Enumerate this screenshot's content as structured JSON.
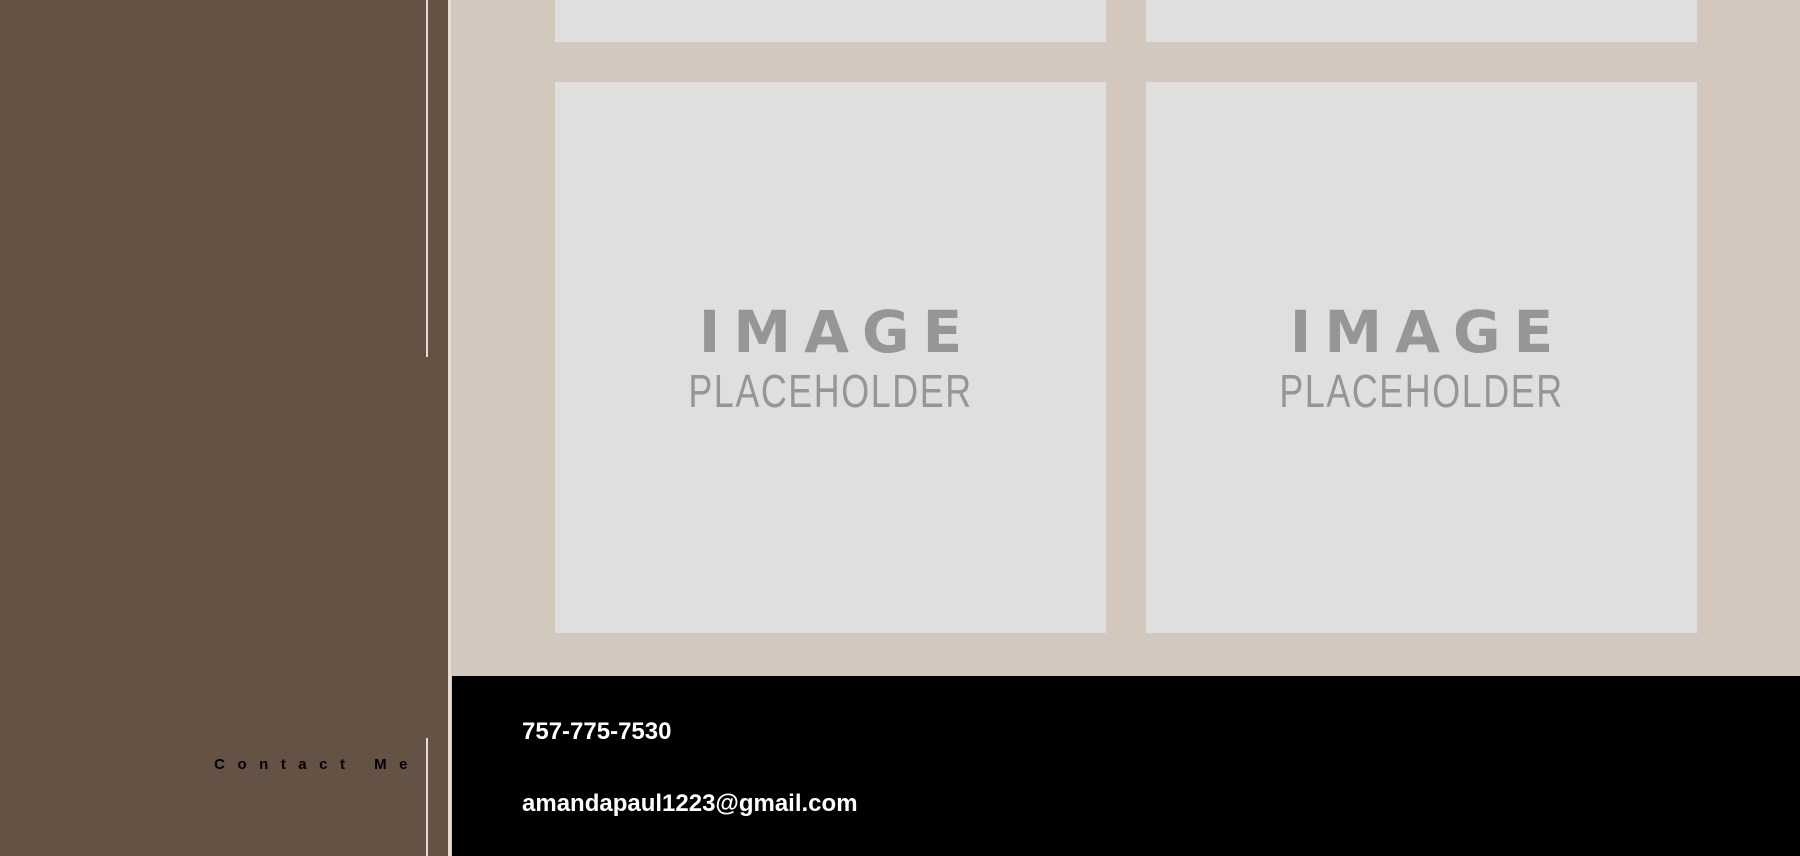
{
  "sidebar": {
    "nav_link": "Contact Me",
    "background_color": "#645244",
    "line_color": "#e6dcd2"
  },
  "gallery": {
    "background_color": "#d3c8bd",
    "tile_color": "#dfdfdf",
    "placeholder_line1": "IMAGE",
    "placeholder_line2": "PLACEHOLDER"
  },
  "footer": {
    "phone": "757-775-7530",
    "email": "amandapaul1223@gmail.com",
    "background_color": "#000000",
    "text_color": "#ffffff"
  }
}
